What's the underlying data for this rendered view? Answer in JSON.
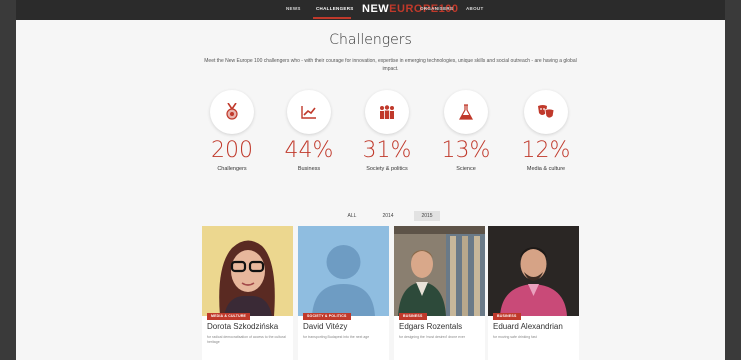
{
  "nav": {
    "items": [
      "NEWS",
      "CHALLENGERS",
      "ORGANISERS",
      "ABOUT"
    ],
    "logo": {
      "prefix": "NEW",
      "suffix": "EUROPE100"
    },
    "colors": {
      "accent": "#c0392b",
      "bar": "#2b2b2b"
    }
  },
  "page": {
    "title": "Challengers",
    "intro": "Meet the New Europe 100 challengers who - with their courage for innovation, expertise in emerging technologies, unique skills and social outreach - are having a global impact."
  },
  "stats": [
    {
      "value": "200",
      "label": "Challengers",
      "icon": "medal-icon"
    },
    {
      "value": "44%",
      "label": "Business",
      "icon": "line-chart-icon"
    },
    {
      "value": "31%",
      "label": "Society & politics",
      "icon": "people-icon"
    },
    {
      "value": "13%",
      "label": "Science",
      "icon": "flask-icon"
    },
    {
      "value": "12%",
      "label": "Media & culture",
      "icon": "theater-masks-icon"
    }
  ],
  "filters": {
    "all": "ALL",
    "y2014": "2014",
    "y2015": "2015",
    "selected": "2015"
  },
  "cards": [
    {
      "tag": "MEDIA & CULTURE",
      "name": "Dorota Szkodzińska",
      "desc": "for radical democratisation of access to the cultural heritage"
    },
    {
      "tag": "SOCIETY & POLITICS",
      "name": "David Vitézy",
      "desc": "for transporting Budapest into the next age"
    },
    {
      "tag": "BUSINESS",
      "name": "Edgars Rozentals",
      "desc": "for designing the 'most desired' drone ever"
    },
    {
      "tag": "BUSINESS",
      "name": "Eduard Alexandrian",
      "desc": "for moving safe drinking fast"
    }
  ]
}
